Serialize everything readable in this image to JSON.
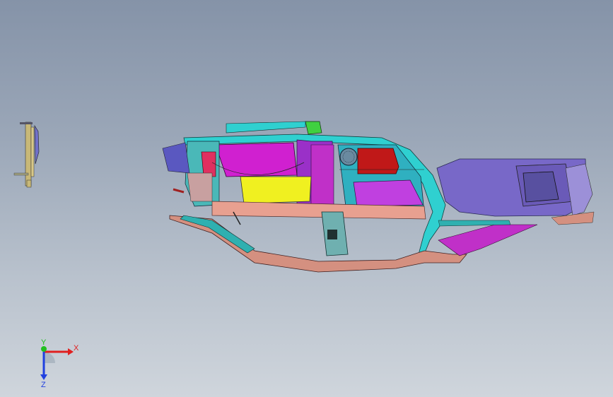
{
  "viewport": {
    "background_top": "#8593a8",
    "background_bottom": "#cfd5dc"
  },
  "model": {
    "description_icon": "car-body-assembly-icon",
    "part_colors": {
      "teal": "#2fd0d0",
      "magenta": "#d020d0",
      "yellow": "#f0f020",
      "purple": "#7868c8",
      "red": "#c01818",
      "salmon": "#e8a090",
      "green": "#40d040",
      "lavender": "#8080d8"
    }
  },
  "triad": {
    "x_label": "X",
    "y_label": "Y",
    "z_label": "Z",
    "x_color": "#e02020",
    "y_color": "#20c020",
    "z_color": "#2040e0"
  }
}
